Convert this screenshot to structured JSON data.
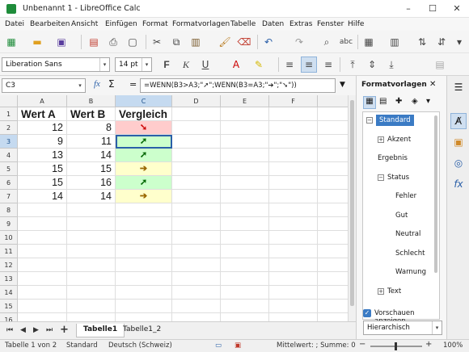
{
  "window": {
    "title": "Unbenannt 1 - LibreOffice Calc",
    "app_icon": "calc-icon"
  },
  "menu": [
    "Datei",
    "Bearbeiten",
    "Ansicht",
    "Einfügen",
    "Format",
    "Formatvorlagen",
    "Tabelle",
    "Daten",
    "Extras",
    "Fenster",
    "Hilfe"
  ],
  "format_toolbar": {
    "font_name": "Liberation Sans",
    "font_size": "14 pt",
    "bold": "F",
    "italic": "K",
    "underline": "U"
  },
  "formula_bar": {
    "cell_ref": "C3",
    "fx": "fx",
    "sum": "Σ",
    "eq": "=",
    "formula": "=WENN(B3>A3;\"➚\";WENN(B3=A3;\"➔\";\"➘\"))"
  },
  "columns": [
    "A",
    "B",
    "C",
    "D",
    "E",
    "F"
  ],
  "rows": [
    "1",
    "2",
    "3",
    "4",
    "5",
    "6",
    "7",
    "8",
    "9",
    "10",
    "11",
    "12",
    "13",
    "14",
    "15",
    "16"
  ],
  "table": {
    "headers": [
      "Wert A",
      "Wert B",
      "Vergleich"
    ],
    "data": [
      {
        "a": "12",
        "b": "8",
        "c": "➘",
        "status": "down"
      },
      {
        "a": "9",
        "b": "11",
        "c": "➚",
        "status": "up"
      },
      {
        "a": "13",
        "b": "14",
        "c": "➚",
        "status": "up"
      },
      {
        "a": "15",
        "b": "15",
        "c": "➔",
        "status": "equal"
      },
      {
        "a": "15",
        "b": "16",
        "c": "➚",
        "status": "up"
      },
      {
        "a": "14",
        "b": "14",
        "c": "➔",
        "status": "equal"
      }
    ]
  },
  "colors": {
    "down_bg": "#ffcccc",
    "up_bg": "#ccffcc",
    "equal_bg": "#ffffcc",
    "selection": "#3b7bc4"
  },
  "sheets": {
    "tabs": [
      "Tabelle1",
      "Tabelle1_2"
    ],
    "active": "Tabelle1"
  },
  "status": {
    "sheet_info": "Tabelle 1 von 2",
    "page_style": "Standard",
    "language": "Deutsch (Schweiz)",
    "sum_info": "Mittelwert: ; Summe: 0",
    "zoom": "100%"
  },
  "sidebar": {
    "title": "Formatvorlagen",
    "styles": [
      {
        "label": "Standard",
        "level": 0,
        "expander": "−",
        "selected": true
      },
      {
        "label": "Akzent",
        "level": 1,
        "expander": "+"
      },
      {
        "label": "Ergebnis",
        "level": 1
      },
      {
        "label": "Status",
        "level": 1,
        "expander": "−"
      },
      {
        "label": "Fehler",
        "level": 2
      },
      {
        "label": "Gut",
        "level": 2
      },
      {
        "label": "Neutral",
        "level": 2
      },
      {
        "label": "Schlecht",
        "level": 2
      },
      {
        "label": "Warnung",
        "level": 2
      },
      {
        "label": "Text",
        "level": 1,
        "expander": "+"
      }
    ],
    "preview_label": "Vorschauen anzeigen",
    "filter": "Hierarchisch"
  }
}
